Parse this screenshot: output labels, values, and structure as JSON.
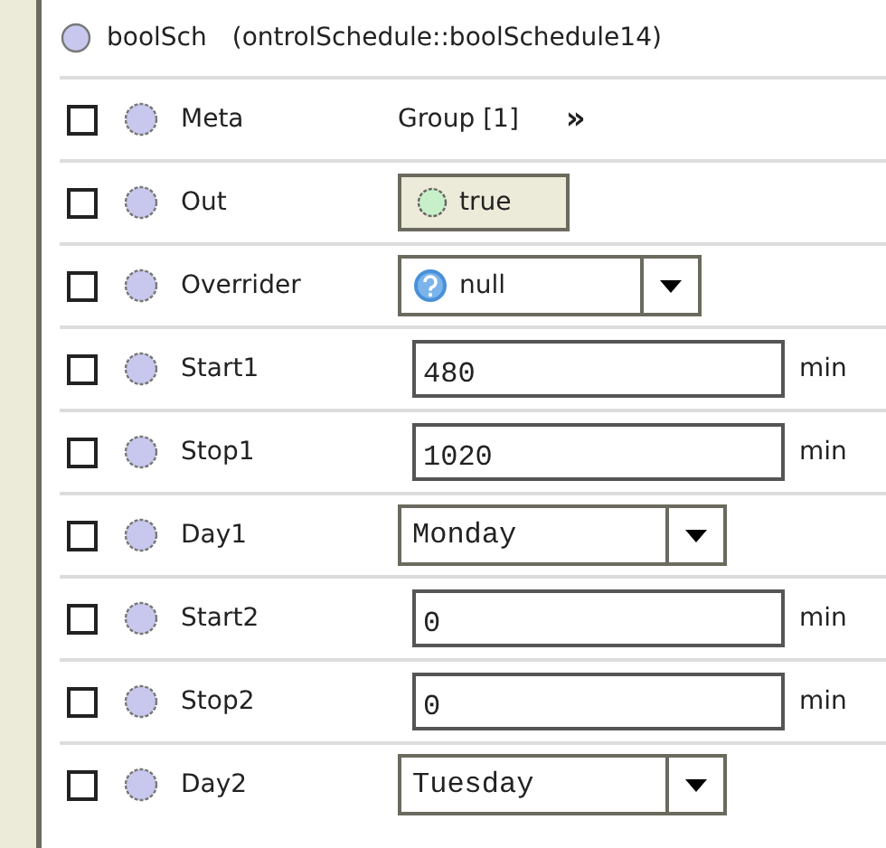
{
  "header": {
    "name": "boolSch",
    "type": "(ontrolSchedule::boolSchedule14)"
  },
  "rows": [
    {
      "label": "Meta",
      "checked": false,
      "kind": "link",
      "value": "Group [1]",
      "action": "»"
    },
    {
      "label": "Out",
      "checked": false,
      "kind": "status",
      "value": "true"
    },
    {
      "label": "Overrider",
      "checked": false,
      "kind": "choice-icon",
      "value": "null"
    },
    {
      "label": "Start1",
      "checked": false,
      "kind": "number",
      "value": "480",
      "unit": "min"
    },
    {
      "label": "Stop1",
      "checked": false,
      "kind": "number",
      "value": "1020",
      "unit": "min"
    },
    {
      "label": "Day1",
      "checked": false,
      "kind": "choice",
      "value": "Monday"
    },
    {
      "label": "Start2",
      "checked": false,
      "kind": "number",
      "value": "0",
      "unit": "min"
    },
    {
      "label": "Stop2",
      "checked": false,
      "kind": "number",
      "value": "0",
      "unit": "min"
    },
    {
      "label": "Day2",
      "checked": false,
      "kind": "choice",
      "value": "Tuesday"
    }
  ]
}
